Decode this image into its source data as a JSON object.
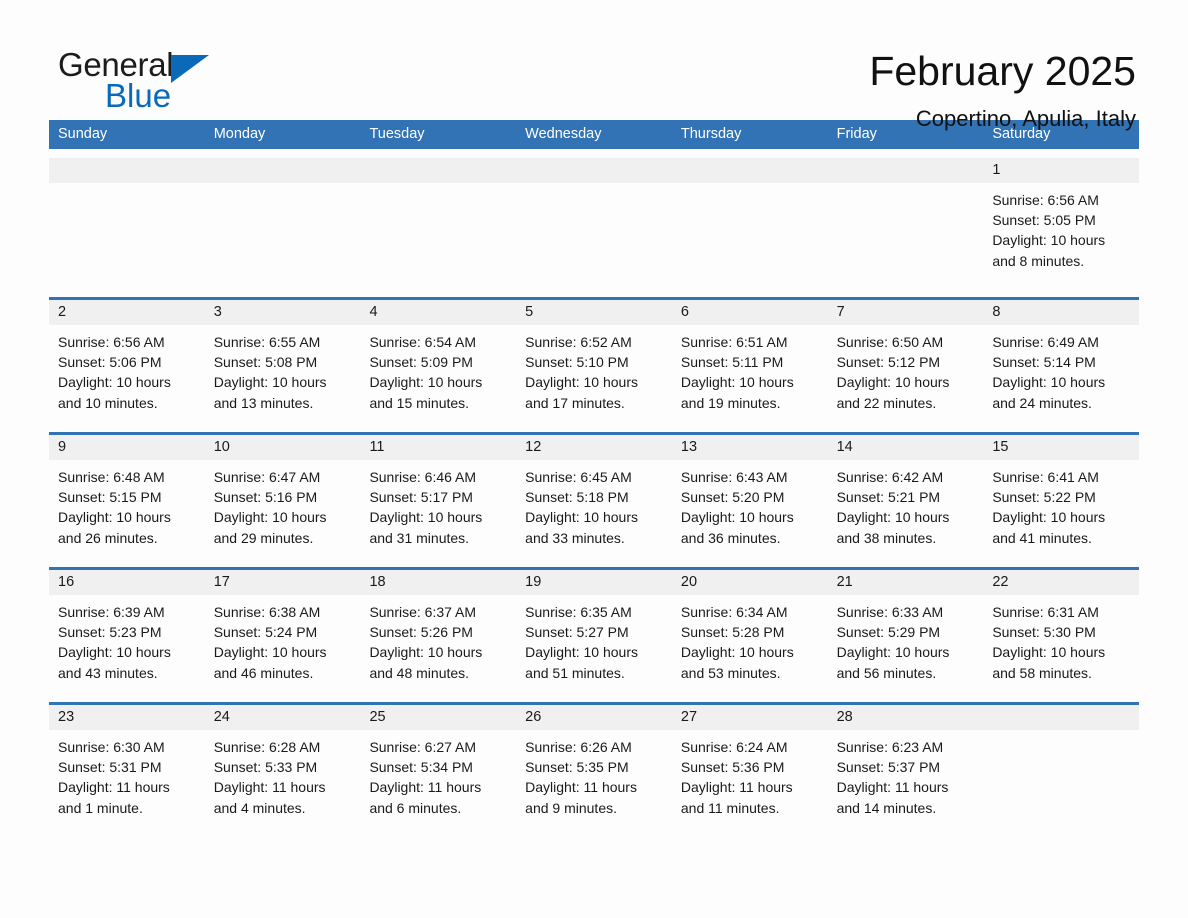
{
  "brand": {
    "name_top": "General",
    "name_bottom": "Blue",
    "triangle_color": "#0a69b8"
  },
  "header": {
    "title": "February 2025",
    "location": "Copertino, Apulia, Italy"
  },
  "theme": {
    "header_blue": "#3173b5",
    "daynum_band": "#f0f0f0",
    "page_background": "#fdfdfd",
    "text": "#1a1a1a"
  },
  "weekdays": [
    "Sunday",
    "Monday",
    "Tuesday",
    "Wednesday",
    "Thursday",
    "Friday",
    "Saturday"
  ],
  "weeks": [
    [
      {
        "day": "",
        "sunrise": "",
        "sunset": "",
        "daylight1": "",
        "daylight2": ""
      },
      {
        "day": "",
        "sunrise": "",
        "sunset": "",
        "daylight1": "",
        "daylight2": ""
      },
      {
        "day": "",
        "sunrise": "",
        "sunset": "",
        "daylight1": "",
        "daylight2": ""
      },
      {
        "day": "",
        "sunrise": "",
        "sunset": "",
        "daylight1": "",
        "daylight2": ""
      },
      {
        "day": "",
        "sunrise": "",
        "sunset": "",
        "daylight1": "",
        "daylight2": ""
      },
      {
        "day": "",
        "sunrise": "",
        "sunset": "",
        "daylight1": "",
        "daylight2": ""
      },
      {
        "day": "1",
        "sunrise": "Sunrise: 6:56 AM",
        "sunset": "Sunset: 5:05 PM",
        "daylight1": "Daylight: 10 hours",
        "daylight2": "and 8 minutes."
      }
    ],
    [
      {
        "day": "2",
        "sunrise": "Sunrise: 6:56 AM",
        "sunset": "Sunset: 5:06 PM",
        "daylight1": "Daylight: 10 hours",
        "daylight2": "and 10 minutes."
      },
      {
        "day": "3",
        "sunrise": "Sunrise: 6:55 AM",
        "sunset": "Sunset: 5:08 PM",
        "daylight1": "Daylight: 10 hours",
        "daylight2": "and 13 minutes."
      },
      {
        "day": "4",
        "sunrise": "Sunrise: 6:54 AM",
        "sunset": "Sunset: 5:09 PM",
        "daylight1": "Daylight: 10 hours",
        "daylight2": "and 15 minutes."
      },
      {
        "day": "5",
        "sunrise": "Sunrise: 6:52 AM",
        "sunset": "Sunset: 5:10 PM",
        "daylight1": "Daylight: 10 hours",
        "daylight2": "and 17 minutes."
      },
      {
        "day": "6",
        "sunrise": "Sunrise: 6:51 AM",
        "sunset": "Sunset: 5:11 PM",
        "daylight1": "Daylight: 10 hours",
        "daylight2": "and 19 minutes."
      },
      {
        "day": "7",
        "sunrise": "Sunrise: 6:50 AM",
        "sunset": "Sunset: 5:12 PM",
        "daylight1": "Daylight: 10 hours",
        "daylight2": "and 22 minutes."
      },
      {
        "day": "8",
        "sunrise": "Sunrise: 6:49 AM",
        "sunset": "Sunset: 5:14 PM",
        "daylight1": "Daylight: 10 hours",
        "daylight2": "and 24 minutes."
      }
    ],
    [
      {
        "day": "9",
        "sunrise": "Sunrise: 6:48 AM",
        "sunset": "Sunset: 5:15 PM",
        "daylight1": "Daylight: 10 hours",
        "daylight2": "and 26 minutes."
      },
      {
        "day": "10",
        "sunrise": "Sunrise: 6:47 AM",
        "sunset": "Sunset: 5:16 PM",
        "daylight1": "Daylight: 10 hours",
        "daylight2": "and 29 minutes."
      },
      {
        "day": "11",
        "sunrise": "Sunrise: 6:46 AM",
        "sunset": "Sunset: 5:17 PM",
        "daylight1": "Daylight: 10 hours",
        "daylight2": "and 31 minutes."
      },
      {
        "day": "12",
        "sunrise": "Sunrise: 6:45 AM",
        "sunset": "Sunset: 5:18 PM",
        "daylight1": "Daylight: 10 hours",
        "daylight2": "and 33 minutes."
      },
      {
        "day": "13",
        "sunrise": "Sunrise: 6:43 AM",
        "sunset": "Sunset: 5:20 PM",
        "daylight1": "Daylight: 10 hours",
        "daylight2": "and 36 minutes."
      },
      {
        "day": "14",
        "sunrise": "Sunrise: 6:42 AM",
        "sunset": "Sunset: 5:21 PM",
        "daylight1": "Daylight: 10 hours",
        "daylight2": "and 38 minutes."
      },
      {
        "day": "15",
        "sunrise": "Sunrise: 6:41 AM",
        "sunset": "Sunset: 5:22 PM",
        "daylight1": "Daylight: 10 hours",
        "daylight2": "and 41 minutes."
      }
    ],
    [
      {
        "day": "16",
        "sunrise": "Sunrise: 6:39 AM",
        "sunset": "Sunset: 5:23 PM",
        "daylight1": "Daylight: 10 hours",
        "daylight2": "and 43 minutes."
      },
      {
        "day": "17",
        "sunrise": "Sunrise: 6:38 AM",
        "sunset": "Sunset: 5:24 PM",
        "daylight1": "Daylight: 10 hours",
        "daylight2": "and 46 minutes."
      },
      {
        "day": "18",
        "sunrise": "Sunrise: 6:37 AM",
        "sunset": "Sunset: 5:26 PM",
        "daylight1": "Daylight: 10 hours",
        "daylight2": "and 48 minutes."
      },
      {
        "day": "19",
        "sunrise": "Sunrise: 6:35 AM",
        "sunset": "Sunset: 5:27 PM",
        "daylight1": "Daylight: 10 hours",
        "daylight2": "and 51 minutes."
      },
      {
        "day": "20",
        "sunrise": "Sunrise: 6:34 AM",
        "sunset": "Sunset: 5:28 PM",
        "daylight1": "Daylight: 10 hours",
        "daylight2": "and 53 minutes."
      },
      {
        "day": "21",
        "sunrise": "Sunrise: 6:33 AM",
        "sunset": "Sunset: 5:29 PM",
        "daylight1": "Daylight: 10 hours",
        "daylight2": "and 56 minutes."
      },
      {
        "day": "22",
        "sunrise": "Sunrise: 6:31 AM",
        "sunset": "Sunset: 5:30 PM",
        "daylight1": "Daylight: 10 hours",
        "daylight2": "and 58 minutes."
      }
    ],
    [
      {
        "day": "23",
        "sunrise": "Sunrise: 6:30 AM",
        "sunset": "Sunset: 5:31 PM",
        "daylight1": "Daylight: 11 hours",
        "daylight2": "and 1 minute."
      },
      {
        "day": "24",
        "sunrise": "Sunrise: 6:28 AM",
        "sunset": "Sunset: 5:33 PM",
        "daylight1": "Daylight: 11 hours",
        "daylight2": "and 4 minutes."
      },
      {
        "day": "25",
        "sunrise": "Sunrise: 6:27 AM",
        "sunset": "Sunset: 5:34 PM",
        "daylight1": "Daylight: 11 hours",
        "daylight2": "and 6 minutes."
      },
      {
        "day": "26",
        "sunrise": "Sunrise: 6:26 AM",
        "sunset": "Sunset: 5:35 PM",
        "daylight1": "Daylight: 11 hours",
        "daylight2": "and 9 minutes."
      },
      {
        "day": "27",
        "sunrise": "Sunrise: 6:24 AM",
        "sunset": "Sunset: 5:36 PM",
        "daylight1": "Daylight: 11 hours",
        "daylight2": "and 11 minutes."
      },
      {
        "day": "28",
        "sunrise": "Sunrise: 6:23 AM",
        "sunset": "Sunset: 5:37 PM",
        "daylight1": "Daylight: 11 hours",
        "daylight2": "and 14 minutes."
      },
      {
        "day": "",
        "sunrise": "",
        "sunset": "",
        "daylight1": "",
        "daylight2": ""
      }
    ]
  ]
}
